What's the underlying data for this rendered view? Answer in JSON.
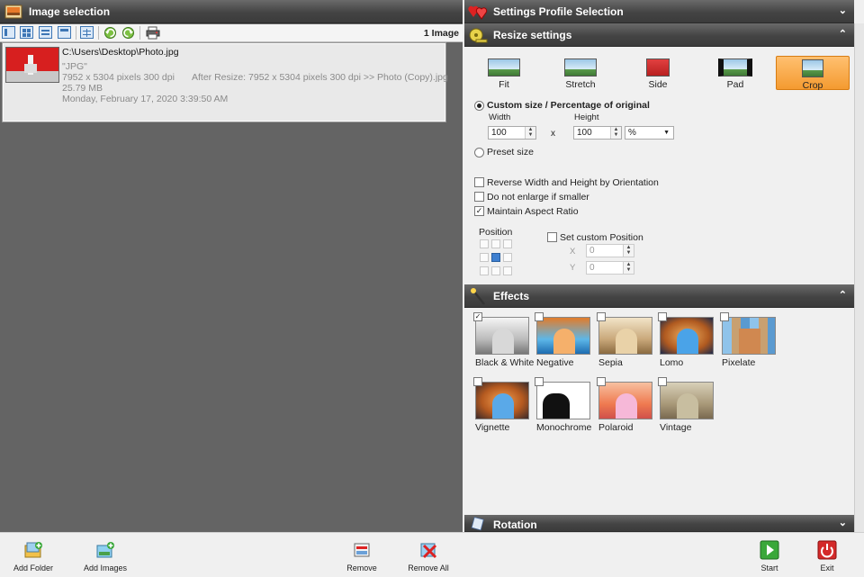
{
  "left_panel": {
    "title": "Image selection",
    "image_count": "1 Image",
    "toolbar_icons": [
      "view-list-icon",
      "view-thumbnails-icon",
      "view-details-icon",
      "view-large-icon",
      "view-grid-icon",
      "rotate-left-icon",
      "rotate-right-icon",
      "printer-icon"
    ]
  },
  "image": {
    "path": "C:\\Users\\Desktop\\Photo.jpg",
    "format": "\"JPG\"",
    "dimensions": "7952 x 5304 pixels 300 dpi",
    "after_resize": "After Resize: 7952 x 5304 pixels 300 dpi >> Photo (Copy).jpg",
    "size": "25.79 MB",
    "date": "Monday, February 17, 2020 3:39:50 AM"
  },
  "profile_header": {
    "title": "Settings Profile Selection"
  },
  "resize": {
    "title": "Resize settings",
    "modes": [
      {
        "label": "Fit",
        "active": false
      },
      {
        "label": "Stretch",
        "active": false
      },
      {
        "label": "Side",
        "active": false
      },
      {
        "label": "Pad",
        "active": false
      },
      {
        "label": "Crop",
        "active": true
      }
    ],
    "custom_size_label": "Custom size / Percentage of original",
    "width_label": "Width",
    "height_label": "Height",
    "width_value": "100",
    "height_value": "100",
    "times_symbol": "x",
    "unit_value": "%",
    "preset_label": "Preset size",
    "options": [
      {
        "label": "Reverse Width and Height by Orientation",
        "checked": false
      },
      {
        "label": "Do not enlarge if smaller",
        "checked": false
      },
      {
        "label": "Maintain Aspect Ratio",
        "checked": true
      }
    ],
    "position_label": "Position",
    "set_custom_position_label": "Set custom Position",
    "x_label": "X",
    "y_label": "Y",
    "x_value": "0",
    "y_value": "0"
  },
  "effects": {
    "title": "Effects",
    "items": [
      {
        "label": "Black & White",
        "checked": true
      },
      {
        "label": "Negative",
        "checked": false
      },
      {
        "label": "Sepia",
        "checked": false
      },
      {
        "label": "Lomo",
        "checked": false
      },
      {
        "label": "Pixelate",
        "checked": false
      },
      {
        "label": "Vignette",
        "checked": false
      },
      {
        "label": "Monochrome",
        "checked": false
      },
      {
        "label": "Polaroid",
        "checked": false
      },
      {
        "label": "Vintage",
        "checked": false
      }
    ]
  },
  "rotation": {
    "title": "Rotation"
  },
  "bottom_bar": {
    "add_folder": "Add Folder",
    "add_images": "Add Images",
    "remove": "Remove",
    "remove_all": "Remove All",
    "start": "Start",
    "exit": "Exit"
  },
  "colors": {
    "accent_orange": "#f49a30",
    "header_dark": "#444444",
    "start_green": "#3aa83a",
    "exit_red": "#d42a2a"
  }
}
